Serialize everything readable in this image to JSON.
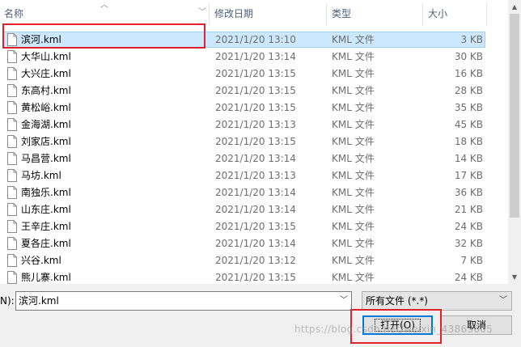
{
  "columns": {
    "name": "名称",
    "date": "修改日期",
    "type": "类型",
    "size": "大小"
  },
  "files": [
    {
      "name": "滨河.kml",
      "date": "2021/1/20 13:10",
      "type": "KML 文件",
      "size": "3 KB",
      "selected": true
    },
    {
      "name": "大华山.kml",
      "date": "2021/1/20 13:14",
      "type": "KML 文件",
      "size": "30 KB"
    },
    {
      "name": "大兴庄.kml",
      "date": "2021/1/20 13:15",
      "type": "KML 文件",
      "size": "16 KB"
    },
    {
      "name": "东高村.kml",
      "date": "2021/1/20 13:15",
      "type": "KML 文件",
      "size": "28 KB"
    },
    {
      "name": "黄松峪.kml",
      "date": "2021/1/20 13:15",
      "type": "KML 文件",
      "size": "35 KB"
    },
    {
      "name": "金海湖.kml",
      "date": "2021/1/20 13:13",
      "type": "KML 文件",
      "size": "45 KB"
    },
    {
      "name": "刘家店.kml",
      "date": "2021/1/20 13:15",
      "type": "KML 文件",
      "size": "18 KB"
    },
    {
      "name": "马昌营.kml",
      "date": "2021/1/20 13:14",
      "type": "KML 文件",
      "size": "14 KB"
    },
    {
      "name": "马坊.kml",
      "date": "2021/1/20 13:13",
      "type": "KML 文件",
      "size": "17 KB"
    },
    {
      "name": "南独乐.kml",
      "date": "2021/1/20 13:14",
      "type": "KML 文件",
      "size": "36 KB"
    },
    {
      "name": "山东庄.kml",
      "date": "2021/1/20 13:14",
      "type": "KML 文件",
      "size": "21 KB"
    },
    {
      "name": "王辛庄.kml",
      "date": "2021/1/20 13:15",
      "type": "KML 文件",
      "size": "24 KB"
    },
    {
      "name": "夏各庄.kml",
      "date": "2021/1/20 13:14",
      "type": "KML 文件",
      "size": "32 KB"
    },
    {
      "name": "兴谷.kml",
      "date": "2021/1/20 13:12",
      "type": "KML 文件",
      "size": "7 KB"
    },
    {
      "name": "熊儿寨.kml",
      "date": "2021/1/20 13:15",
      "type": "KML 文件",
      "size": "24 KB"
    }
  ],
  "footer": {
    "filename_label": "N):",
    "filename_value": "滨河.kml",
    "filetype_value": "所有文件 (*.*)",
    "open_label": "打开(O)",
    "cancel_label": "取消"
  },
  "watermark": "https://blog.csdn.net/weixin_43863605"
}
